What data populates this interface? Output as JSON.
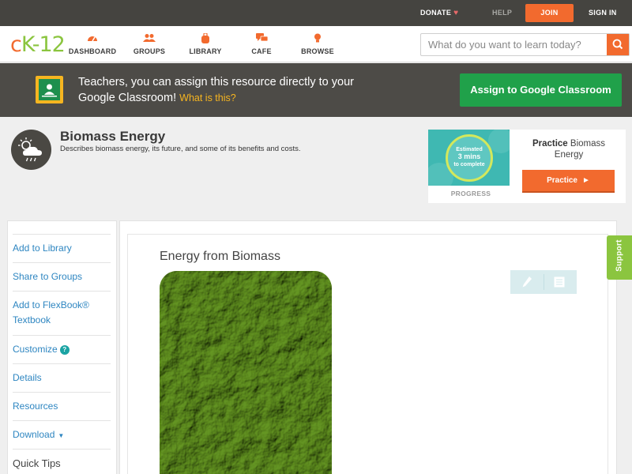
{
  "topbar": {
    "donate": "DONATE",
    "help": "HELP",
    "join": "JOIN",
    "signin": "SIGN IN"
  },
  "logo": {
    "c": "c",
    "k": "K",
    "dash": "-",
    "num": "12"
  },
  "nav": {
    "items": [
      {
        "label": "DASHBOARD",
        "icon": "dashboard-icon"
      },
      {
        "label": "GROUPS",
        "icon": "groups-icon"
      },
      {
        "label": "LIBRARY",
        "icon": "library-icon"
      },
      {
        "label": "CAFE",
        "icon": "cafe-icon"
      },
      {
        "label": "BROWSE",
        "icon": "browse-icon"
      }
    ]
  },
  "search": {
    "placeholder": "What do you want to learn today?"
  },
  "banner": {
    "text": "Teachers, you can assign this resource directly to your Google Classroom!",
    "what": "What is this?",
    "assign": "Assign to Google Classroom"
  },
  "concept": {
    "title": "Biomass Energy",
    "description": "Describes biomass energy, its future, and some of its benefits and costs."
  },
  "practice": {
    "estimated": "Estimated",
    "mins": "3 mins",
    "complete": "to complete",
    "progress_label": "PROGRESS",
    "title_bold": "Practice",
    "title_rest": "Biomass Energy",
    "button": "Practice"
  },
  "sidebar": {
    "add_library": "Add to Library",
    "share_groups": "Share to Groups",
    "add_flexbook": "Add to FlexBook® Textbook",
    "customize": "Customize",
    "details": "Details",
    "resources": "Resources",
    "download": "Download",
    "quick_tips": "Quick Tips"
  },
  "content": {
    "title": "Energy from Biomass"
  },
  "support": "Support",
  "colors": {
    "brand_orange": "#f26a2e",
    "brand_green": "#8bc53f",
    "assign_green": "#20a14a",
    "link_blue": "#2e86c1",
    "topbar": "#454440",
    "banner": "#4d4b47"
  }
}
